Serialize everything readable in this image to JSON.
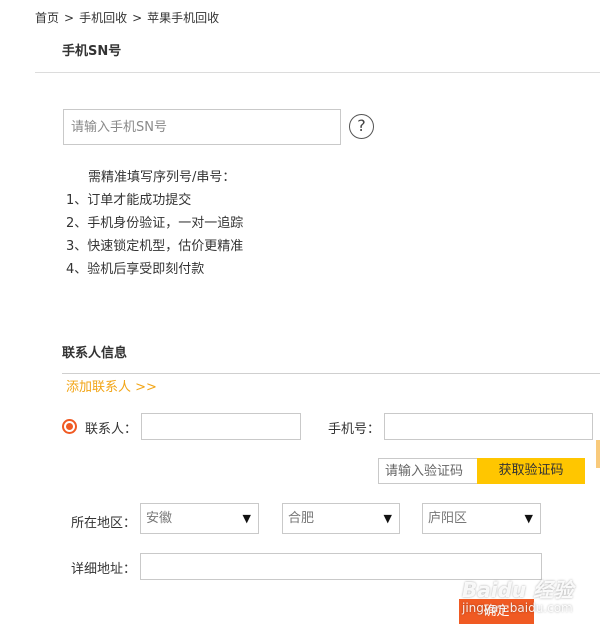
{
  "breadcrumb": {
    "home": "首页",
    "level1": "手机回收",
    "level2": "苹果手机回收",
    "separator": ">"
  },
  "sn_section": {
    "title": "手机SN号",
    "input_placeholder": "请输入手机SN号",
    "help_icon": "question-mark-icon",
    "help_glyph": "?",
    "notes_header": "需精准填写序列号/串号：",
    "notes": [
      "1、订单才能成功提交",
      "2、手机身份验证，一对一追踪",
      "3、快速锁定机型，估价更精准",
      "4、验机后享受即刻付款"
    ]
  },
  "contact_section": {
    "title": "联系人信息",
    "add_contact_label": "添加联系人 >>",
    "contact_label": "联系人：",
    "phone_label": "手机号：",
    "code_placeholder": "请输入验证码",
    "get_code_label": "获取验证码",
    "region_label": "所在地区：",
    "province": "安徽",
    "city": "合肥",
    "district": "庐阳区",
    "dropdown_arrow": "▼",
    "address_label": "详细地址：",
    "confirm_label": "确定"
  },
  "watermark": {
    "logo": "Baidu 经验",
    "site": "jingyan.baidu.com"
  },
  "colors": {
    "accent_orange": "#f05a23",
    "button_yellow": "#ffc600",
    "link_yellow": "#f2a516"
  }
}
